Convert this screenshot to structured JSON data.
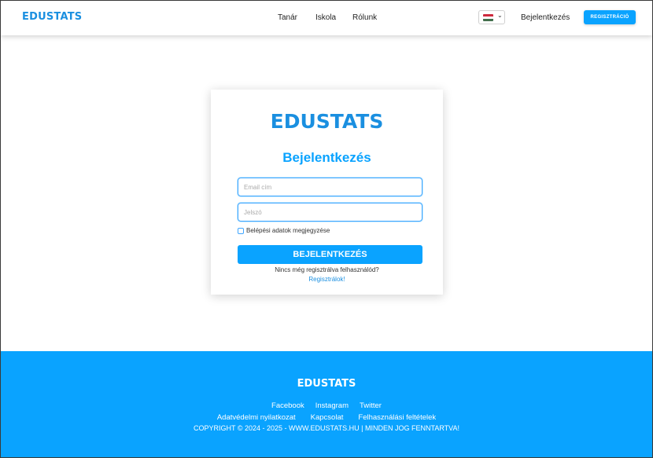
{
  "header": {
    "logo": "EDUSTATS",
    "nav": [
      "Tanár",
      "Iskola",
      "Rólunk"
    ],
    "language": {
      "selected": "hu",
      "flag_colors": [
        "#cd2a3e",
        "#ffffff",
        "#436f4d"
      ]
    },
    "login_label": "Bejelentkezés",
    "register_label": "REGISZTRÁCIÓ"
  },
  "card": {
    "logo": "EDUSTATS",
    "title": "Bejelentkezés",
    "email_placeholder": "Email cím",
    "password_placeholder": "Jelszó",
    "remember_label": "Belépési adatok megjegyzése",
    "remember_checked": false,
    "submit_label": "BEJELENTKEZÉS",
    "no_account_text": "Nincs még regisztrálva felhasználód?",
    "register_link": "Regisztrálok!"
  },
  "footer": {
    "logo": "EDUSTATS",
    "social": [
      "Facebook",
      "Instagram",
      "Twitter"
    ],
    "links": [
      "Adatvédelmi nyilatkozat",
      "Kapcsolat",
      "Felhasználási feltételek"
    ],
    "copyright": "COPYRIGHT © 2024 - 2025 - WWW.EDUSTATS.HU | MINDEN JOG FENNTARTVA!"
  },
  "colors": {
    "brand": "#1a8fe0",
    "accent": "#0aa3ff"
  }
}
